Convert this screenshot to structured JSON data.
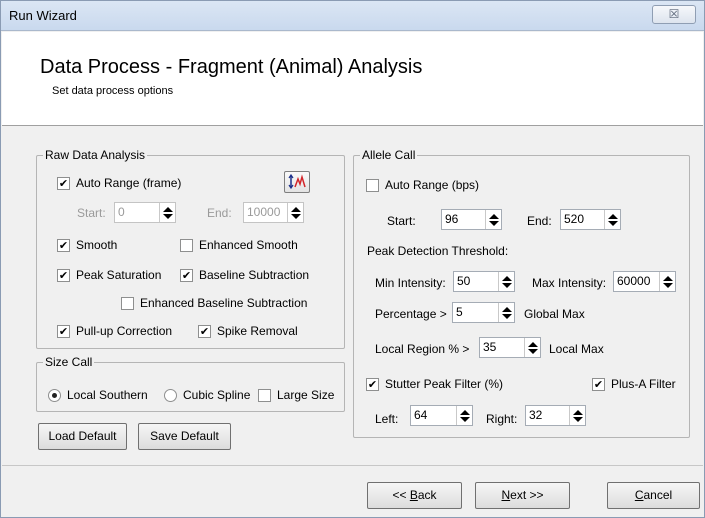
{
  "window": {
    "title": "Run Wizard",
    "close_glyph": "☒"
  },
  "header": {
    "title": "Data Process - Fragment (Animal) Analysis",
    "subtitle": "Set data process options"
  },
  "raw_data": {
    "label": "Raw Data Analysis",
    "auto_range": {
      "label": "Auto Range (frame)",
      "checked": true
    },
    "start_label": "Start:",
    "start_value": "0",
    "end_label": "End:",
    "end_value": "10000",
    "smooth": {
      "label": "Smooth",
      "checked": true
    },
    "enhanced_smooth": {
      "label": "Enhanced Smooth",
      "checked": false
    },
    "peak_saturation": {
      "label": "Peak Saturation",
      "checked": true
    },
    "baseline_subtraction": {
      "label": "Baseline Subtraction",
      "checked": true
    },
    "enhanced_baseline": {
      "label": "Enhanced Baseline Subtraction",
      "checked": false
    },
    "pullup": {
      "label": "Pull-up Correction",
      "checked": true
    },
    "spike_removal": {
      "label": "Spike Removal",
      "checked": true
    },
    "icon": "peak-chart-icon"
  },
  "size_call": {
    "label": "Size Call",
    "local_southern": "Local Southern",
    "cubic_spline": "Cubic Spline",
    "large_size": "Large Size",
    "selected": "local_southern"
  },
  "allele_call": {
    "label": "Allele Call",
    "auto_range": {
      "label": "Auto Range (bps)",
      "checked": false
    },
    "start_label": "Start:",
    "start_value": "96",
    "end_label": "End:",
    "end_value": "520",
    "peak_threshold_label": "Peak Detection Threshold:",
    "min_intensity_label": "Min Intensity:",
    "min_intensity_value": "50",
    "max_intensity_label": "Max Intensity:",
    "max_intensity_value": "60000",
    "percentage_label": "Percentage >",
    "percentage_value": "5",
    "global_max_label": "Global Max",
    "local_region_label": "Local Region % >",
    "local_region_value": "35",
    "local_max_label": "Local Max",
    "stutter": {
      "label": "Stutter Peak Filter (%)",
      "checked": true
    },
    "plus_a": {
      "label": "Plus-A Filter",
      "checked": true
    },
    "left_label": "Left:",
    "left_value": "64",
    "right_label": "Right:",
    "right_value": "32"
  },
  "buttons": {
    "load_default": "Load Default",
    "save_default": "Save Default",
    "back_prefix": "<< ",
    "back_mnemonic": "B",
    "back_rest": "ack",
    "next_mnemonic": "N",
    "next_rest": "ext >>",
    "cancel_mnemonic": "C",
    "cancel_rest": "ancel"
  }
}
